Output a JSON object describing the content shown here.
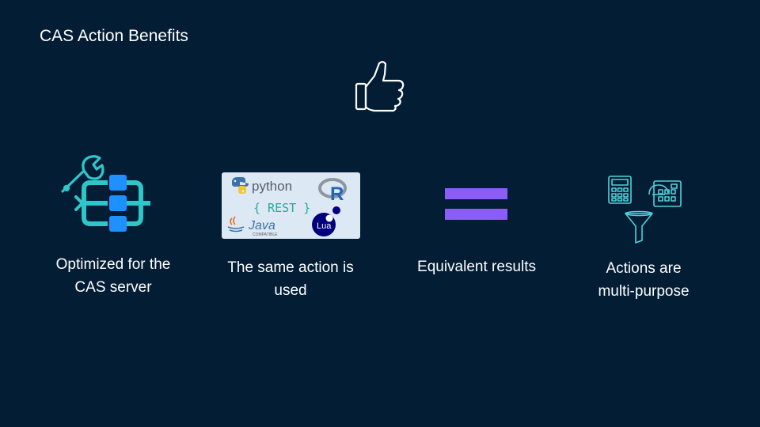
{
  "slide": {
    "title": "CAS Action Benefits",
    "thumbs_up_icon": "thumbs-up-icon"
  },
  "benefits": [
    {
      "icon": "wrench-workflow-icon",
      "line1": "Optimized for the",
      "line2": "CAS server"
    },
    {
      "icon": "language-logos-icon",
      "line1": "The same action is",
      "line2": "used",
      "logos": {
        "python": "python",
        "rest": "{ REST }",
        "r": "R",
        "java": "Java",
        "java_sub": "COMPATIBLE",
        "lua": "Lua"
      }
    },
    {
      "icon": "equals-icon",
      "line1": "Equivalent results",
      "line2": ""
    },
    {
      "icon": "calculator-funnel-icon",
      "line1": "Actions are",
      "line2": "multi-purpose"
    }
  ],
  "colors": {
    "background": "#031d35",
    "teal": "#2ec7c9",
    "blue": "#1e90ff",
    "purple": "#8b5cf6",
    "icon_outline": "#4fd1d9"
  }
}
